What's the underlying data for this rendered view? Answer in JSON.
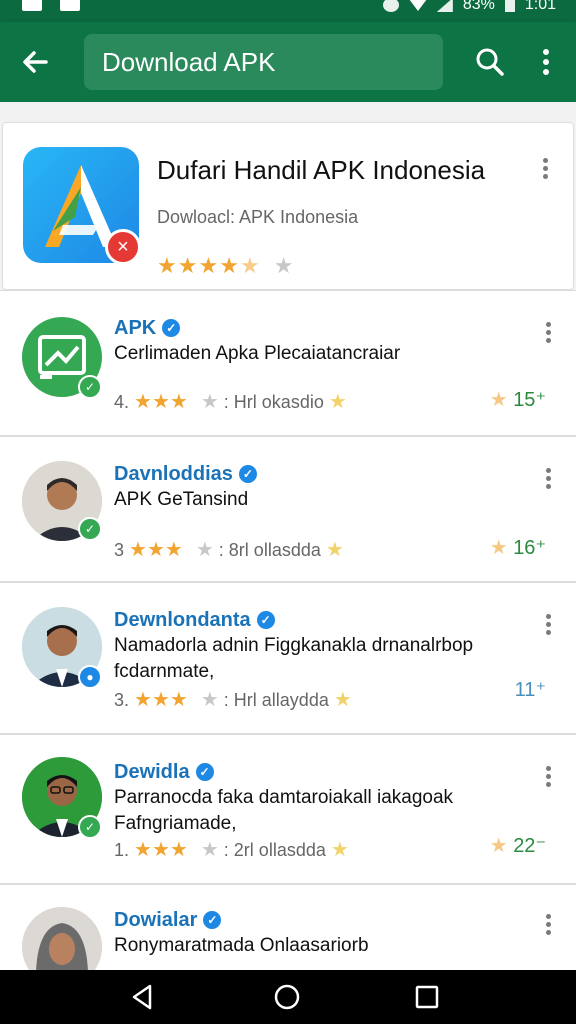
{
  "status": {
    "battery": "83%",
    "time": "1:01"
  },
  "toolbar": {
    "search_text": "Download APK"
  },
  "hero": {
    "title": "Dufari Handil APK Indonesia",
    "subtitle": "Dowloacl: APK Indonesia",
    "rating_stars": 4.5
  },
  "rows": [
    {
      "name": "APK",
      "text": "Cerlimaden Apka Plecaiatancraiar",
      "meta_prefix": "4.",
      "meta_label": ": Hrl okasdio",
      "count": "15",
      "avatar": "app-icon"
    },
    {
      "name": "Davnloddias",
      "text": "APK GeTansind",
      "meta_prefix": "3",
      "meta_label": ": 8rl ollasdda",
      "count": "16",
      "avatar": "person"
    },
    {
      "name": "Dewnlondanta",
      "text": "Namadorla adnin Figgkanakla drnanalrbop fcdarnmate,",
      "meta_prefix": "3.",
      "meta_label": ": Hrl allaydda",
      "count": "11",
      "avatar": "person"
    },
    {
      "name": "Dewidla",
      "text": "Parranocda faka damtaroiakall iakagoak Fafngriamade,",
      "meta_prefix": "1.",
      "meta_label": ": 2rl ollasdda",
      "count": "22",
      "avatar": "person"
    },
    {
      "name": "Dowialar",
      "text": "Ronymaratmada Onlaasariorb",
      "avatar": "person"
    }
  ],
  "colors": {
    "app_bar": "#0d7446",
    "status_bar": "#0b6a3f",
    "link_blue": "#1a73b8",
    "star": "#f2a431",
    "count_green": "#2b8a3e"
  }
}
